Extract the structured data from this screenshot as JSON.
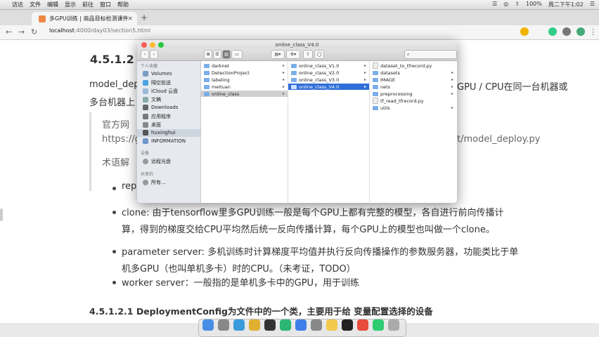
{
  "menubar": {
    "items": [
      "访达",
      "文件",
      "编辑",
      "显示",
      "前往",
      "窗口",
      "帮助"
    ],
    "right": [
      "☰",
      "◎",
      "⇪",
      "100%",
      "周二下午1:02",
      "☰"
    ]
  },
  "browser": {
    "tab_title": "多GPU训练 | 商品目标检测课件",
    "url_host": "localhost",
    "url_path": ":4000/day03/section5.html"
  },
  "page": {
    "heading": "4.5.1.2 m",
    "line1_left": "model_dep",
    "line1_right": "GPU / CPU在同一台机器或",
    "line2_left": "多台机器上",
    "quote_line1": "官方网",
    "quote_line2_left": "https://g",
    "quote_line2_right": "t/model_deploy.py",
    "term_label": "术语解",
    "bullets": [
      {
        "line1": "rep",
        "line2": ""
      },
      {
        "line1": "clone: 由于tensorflow里多GPU训练一般是每个GPU上都有完整的模型，各自进行前向传播计",
        "line2": "算，得到的梯度交给CPU平均然后统一反向传播计算，每个GPU上的模型也叫做一个clone。"
      },
      {
        "line1": "parameter server: 多机训练时计算梯度平均值并执行反向传播操作的参数服务器，功能类比于单",
        "line2": "机多GPU（也叫单机多卡）时的CPU。（未考证，TODO）"
      },
      {
        "line1": "worker server：一般指的是单机多卡中的GPU，用于训练",
        "line2": ""
      }
    ],
    "subheading": "4.5.1.2.1 DeploymentConfig为文件中的一个类，主要用于给 变量配置选择的设备"
  },
  "finder": {
    "title": "online_class_V4.0",
    "sidebar_sections": [
      {
        "header": "个人收藏",
        "items": [
          {
            "label": "Volumes",
            "icon": "drive-icon"
          },
          {
            "label": "隔空投送",
            "icon": "airdrop-icon"
          },
          {
            "label": "iCloud 云盘",
            "icon": "cloud-icon"
          },
          {
            "label": "文稿",
            "icon": "document-icon"
          },
          {
            "label": "Downloads",
            "icon": "download-icon"
          },
          {
            "label": "应用程序",
            "icon": "app-icon"
          },
          {
            "label": "桌面",
            "icon": "desktop-icon"
          },
          {
            "label": "huxinghui",
            "icon": "home-icon"
          },
          {
            "label": "INFORMATION",
            "icon": "folder-icon"
          }
        ]
      },
      {
        "header": "设备",
        "items": [
          {
            "label": "远程光盘",
            "icon": "disc-icon"
          }
        ]
      },
      {
        "header": "共享的",
        "items": [
          {
            "label": "所有...",
            "icon": "network-icon"
          }
        ]
      }
    ],
    "col1": [
      "darknet",
      "DetectionProject",
      "labeling",
      "meituan",
      "online_class"
    ],
    "col2": [
      "online_class_V1.0",
      "online_class_V2.0",
      "online_class_V3.0",
      "online_class_V4.0"
    ],
    "col3": [
      "dataset_to_tfrecord.py",
      "datasets",
      "IMAGE",
      "nets",
      "preprocessing",
      "tf_read_tfrecord.py",
      "utils"
    ],
    "col3_folders": [
      false,
      true,
      true,
      true,
      true,
      false,
      true
    ]
  },
  "dock": {
    "icons": [
      "finder-icon",
      "launchpad-icon",
      "safari-icon",
      "chrome-icon",
      "terminal-icon",
      "pycharm-icon",
      "appstore-icon",
      "system-prefs-icon",
      "notes-icon",
      "typora-icon",
      "calendar-icon",
      "wechat-icon",
      "trash-icon"
    ],
    "colors": [
      "#4a8fe7",
      "#888888",
      "#3a9bdc",
      "#e0b030",
      "#333333",
      "#2bb673",
      "#3f7ee8",
      "#888888",
      "#f2c94c",
      "#222222",
      "#e74c3c",
      "#2ecc71",
      "#aaaaaa"
    ]
  }
}
